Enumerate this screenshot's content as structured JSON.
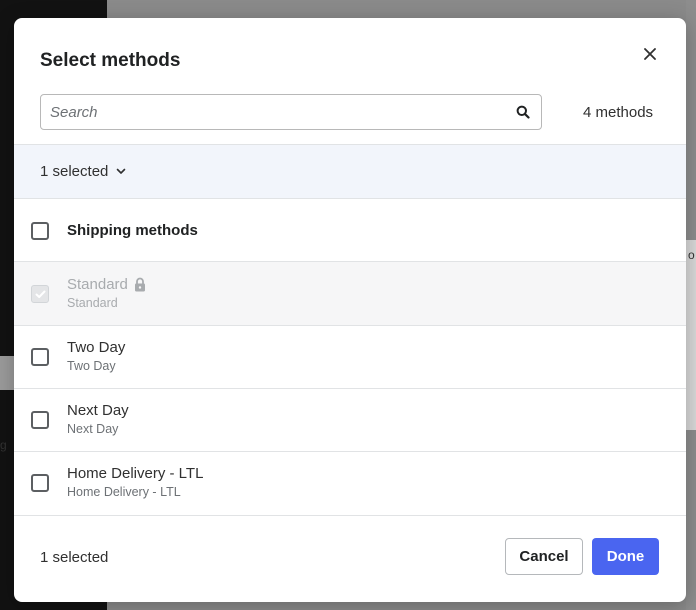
{
  "background": {
    "right_glyph": "o",
    "left_glyph": "g"
  },
  "modal": {
    "title": "Select methods",
    "close_icon": "close-icon",
    "search": {
      "placeholder": "Search",
      "value": "",
      "icon": "search-icon"
    },
    "count_label": "4 methods",
    "selected_toggle": {
      "label": "1 selected",
      "icon": "chevron-down-icon"
    },
    "group": {
      "label": "Shipping methods",
      "checked": false
    },
    "methods": [
      {
        "title": "Standard",
        "subtitle": "Standard",
        "checked": true,
        "disabled": true,
        "locked": true
      },
      {
        "title": "Two Day",
        "subtitle": "Two Day",
        "checked": false,
        "disabled": false,
        "locked": false
      },
      {
        "title": "Next Day",
        "subtitle": "Next Day",
        "checked": false,
        "disabled": false,
        "locked": false
      },
      {
        "title": "Home Delivery - LTL",
        "subtitle": "Home Delivery - LTL",
        "checked": false,
        "disabled": false,
        "locked": false
      }
    ],
    "footer": {
      "selected_count": "1 selected",
      "cancel_label": "Cancel",
      "done_label": "Done"
    }
  },
  "colors": {
    "primary": "#4a65f0",
    "selected_bar_bg": "#f2f5fb",
    "text": "#303030",
    "subdued": "#6d7175"
  }
}
